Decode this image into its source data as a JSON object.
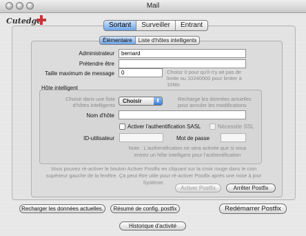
{
  "window": {
    "title": "Mail"
  },
  "app": {
    "logo_text": "Cutedge"
  },
  "main_tabs": [
    {
      "label": "Sortant",
      "active": true
    },
    {
      "label": "Surveiller",
      "active": false
    },
    {
      "label": "Entrant",
      "active": false
    }
  ],
  "sub_tabs": [
    {
      "label": "Élémentaire",
      "active": true
    },
    {
      "label": "Liste d'hôtes intelligents",
      "active": false
    }
  ],
  "fields": {
    "administrator_label": "Administrateur",
    "administrator_value": "bernard",
    "pretend_label": "Prétendre être",
    "pretend_value": "",
    "max_size_label": "Taille maximum de message",
    "max_size_value": "0",
    "max_size_hint": "Choisir 0 pour qu'il n'y ait pas de limite ou 10240000 pour limiter à 10Mo"
  },
  "smarthost": {
    "group_title": "Hôte intelligent",
    "choose_label": "Choisir dans une liste d'hôtes intelligents",
    "choose_value": "Choisir",
    "choose_hint": "Recharge les données actuelles pour annuler les modifications",
    "hostname_label": "Nom d'hôte",
    "hostname_value": "",
    "sasl_label": "Activer l'authentification SASL",
    "ssl_label": "Nécessite SSL",
    "userid_label": "ID-utilisateur",
    "userid_value": "",
    "password_label": "Mot de passe",
    "password_value": "",
    "note": "Note : L'authentification ne sera activée que si vous entrez un hôte intelligent pour l'authentification"
  },
  "info_text": "Vous pouvez ré-activer le bouton Activer Postfix en cliquant sur la croix rouge dans le coin supérieur gauche de la fenêtre. Ça peut être utile pour ré-activer Postfix après une mise à jour Système.",
  "buttons": {
    "activate_postfix": "Activer Postfix",
    "stop_postfix": "Arrêter Postfix",
    "reload": "Recharger les données actuelles.",
    "config_summary": "Résumé de config. postfix",
    "restart_postfix": "Redémarrer Postfix",
    "activity_history": "Historique d'activité"
  }
}
